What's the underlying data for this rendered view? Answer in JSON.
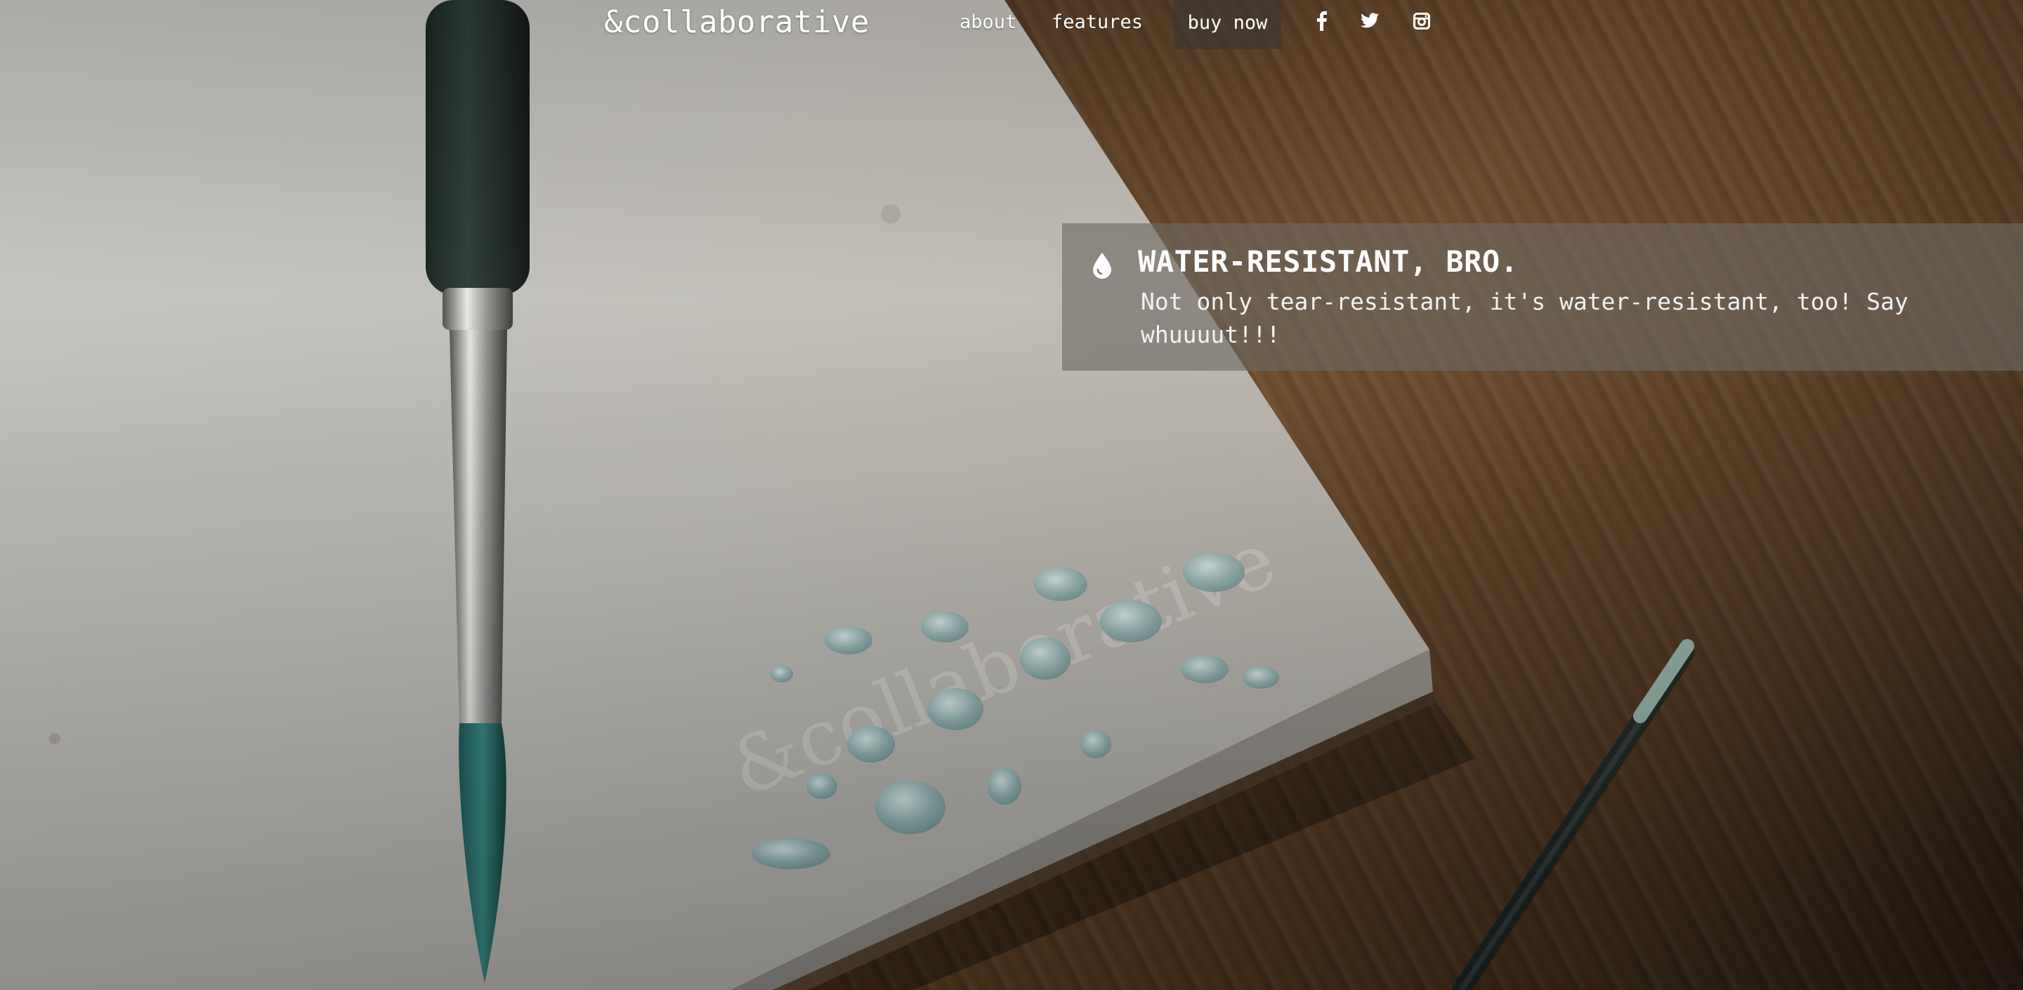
{
  "nav": {
    "brand": "&collaborative",
    "links": [
      "about",
      "features"
    ],
    "cta": "buy now",
    "social": [
      "facebook-icon",
      "twitter-icon",
      "instagram-icon"
    ]
  },
  "hero": {
    "icon": "water-drop-icon",
    "title": "WATER-RESISTANT, BRO.",
    "description": "Not only tear-resistant, it's water-resistant, too! Say whuuuut!!!"
  },
  "colors": {
    "nav_cta_bg": "#3c3732",
    "callout_bg": "#6e6962",
    "text": "#ffffff"
  }
}
